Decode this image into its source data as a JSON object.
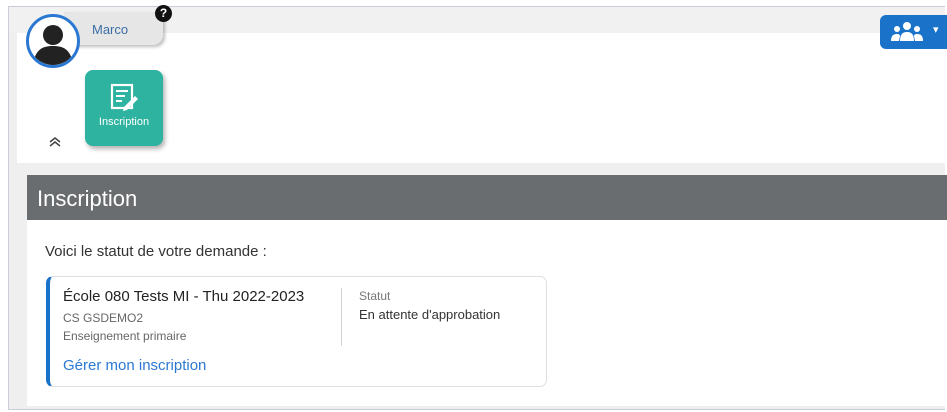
{
  "user": {
    "name": "Marco",
    "help_badge": "?"
  },
  "header": {
    "people_menu_icon": "people-icon",
    "caret": "▾"
  },
  "tile": {
    "label": "Inscription",
    "icon": "edit-form-icon"
  },
  "collapse_icon": "double-chevron-up-icon",
  "section": {
    "title": "Inscription"
  },
  "request": {
    "intro": "Voici le statut de votre demande :",
    "school": "École 080 Tests MI - Thu 2022-2023",
    "code": "CS GSDEMO2",
    "level": "Enseignement primaire",
    "status_label": "Statut",
    "status_value": "En attente d'approbation",
    "manage_link": "Gérer mon inscription"
  },
  "colors": {
    "accent": "#1a73c9",
    "tile": "#2db3a0",
    "section_header": "#6a6d6f"
  }
}
